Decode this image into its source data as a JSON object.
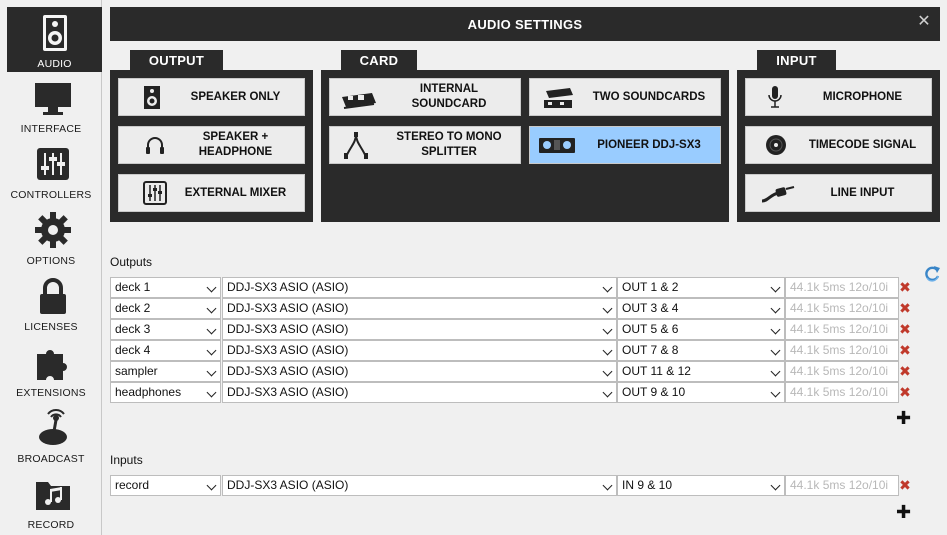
{
  "sidebar": {
    "items": [
      {
        "label": "AUDIO",
        "icon": "speaker-icon",
        "active": true
      },
      {
        "label": "INTERFACE",
        "icon": "monitor-icon"
      },
      {
        "label": "CONTROLLERS",
        "icon": "sliders-icon"
      },
      {
        "label": "OPTIONS",
        "icon": "gear-icon"
      },
      {
        "label": "LICENSES",
        "icon": "lock-icon"
      },
      {
        "label": "EXTENSIONS",
        "icon": "puzzle-icon"
      },
      {
        "label": "BROADCAST",
        "icon": "broadcast-icon"
      },
      {
        "label": "RECORD",
        "icon": "music-folder-icon"
      }
    ]
  },
  "header": {
    "title": "AUDIO SETTINGS",
    "close": "✕"
  },
  "groups": {
    "output": {
      "title": "OUTPUT",
      "options": [
        {
          "label": "SPEAKER ONLY",
          "icon": "speaker-icon"
        },
        {
          "label": "SPEAKER + HEADPHONE",
          "icon": "headphone-icon"
        },
        {
          "label": "EXTERNAL MIXER",
          "icon": "mixer-icon"
        }
      ]
    },
    "card": {
      "title": "CARD",
      "options": [
        {
          "label": "INTERNAL SOUNDCARD",
          "icon": "internal-soundcard-icon"
        },
        {
          "label": "TWO SOUNDCARDS",
          "icon": "two-soundcards-icon"
        },
        {
          "label": "STEREO TO MONO SPLITTER",
          "icon": "splitter-cable-icon"
        },
        {
          "label": "PIONEER DDJ-SX3",
          "icon": "controller-icon",
          "selected": true
        }
      ]
    },
    "input": {
      "title": "INPUT",
      "options": [
        {
          "label": "MICROPHONE",
          "icon": "microphone-icon"
        },
        {
          "label": "TIMECODE SIGNAL",
          "icon": "vinyl-icon"
        },
        {
          "label": "LINE INPUT",
          "icon": "cable-icon"
        }
      ]
    }
  },
  "outputs": {
    "label": "Outputs",
    "rows": [
      {
        "channel": "deck 1",
        "device": "DDJ-SX3 ASIO (ASIO)",
        "ports": "OUT 1 & 2",
        "info": "44.1k 5ms 12o/10i"
      },
      {
        "channel": "deck 2",
        "device": "DDJ-SX3 ASIO (ASIO)",
        "ports": "OUT 3 & 4",
        "info": "44.1k 5ms 12o/10i"
      },
      {
        "channel": "deck 3",
        "device": "DDJ-SX3 ASIO (ASIO)",
        "ports": "OUT 5 & 6",
        "info": "44.1k 5ms 12o/10i"
      },
      {
        "channel": "deck 4",
        "device": "DDJ-SX3 ASIO (ASIO)",
        "ports": "OUT 7 & 8",
        "info": "44.1k 5ms 12o/10i"
      },
      {
        "channel": "sampler",
        "device": "DDJ-SX3 ASIO (ASIO)",
        "ports": "OUT 11 & 12",
        "info": "44.1k 5ms 12o/10i"
      },
      {
        "channel": "headphones",
        "device": "DDJ-SX3 ASIO (ASIO)",
        "ports": "OUT 9 & 10",
        "info": "44.1k 5ms 12o/10i"
      }
    ]
  },
  "inputs": {
    "label": "Inputs",
    "rows": [
      {
        "channel": "record",
        "device": "DDJ-SX3 ASIO (ASIO)",
        "ports": "IN 9 & 10",
        "info": "44.1k 5ms 12o/10i"
      }
    ]
  },
  "symbols": {
    "remove": "✖",
    "add": "✚"
  },
  "colors": {
    "panel": "#2a2a2a",
    "selected": "#99ccff",
    "remove": "#c0392b"
  }
}
